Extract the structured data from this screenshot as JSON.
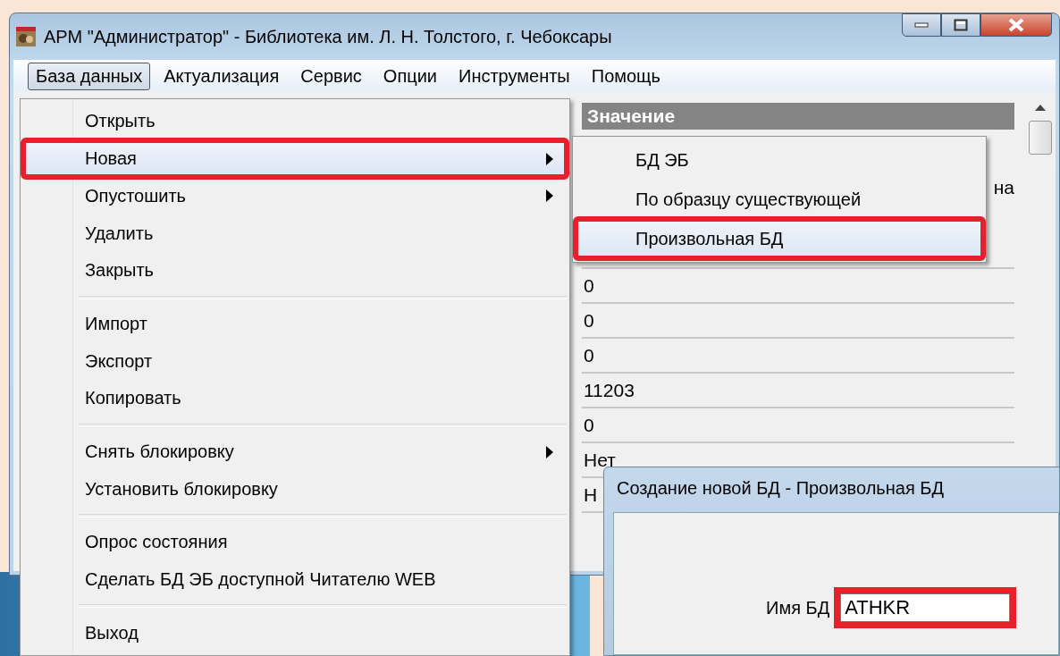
{
  "window": {
    "title": "АРМ \"Администратор\" - Библиотека им. Л. Н. Толстого, г. Чебоксары"
  },
  "menu_bar": [
    {
      "label": "База данных",
      "selected": true
    },
    {
      "label": "Актуализация",
      "selected": false
    },
    {
      "label": "Сервис",
      "selected": false
    },
    {
      "label": "Опции",
      "selected": false
    },
    {
      "label": "Инструменты",
      "selected": false
    },
    {
      "label": "Помощь",
      "selected": false
    }
  ],
  "table": {
    "columns": [
      "Значение"
    ],
    "rows": [
      {
        "value": "на",
        "kind": "clipped"
      },
      {
        "value": "0",
        "kind": "plain"
      },
      {
        "value": "0",
        "kind": "plain"
      },
      {
        "value": "0",
        "kind": "plain"
      },
      {
        "value": "11203",
        "kind": "plain"
      },
      {
        "value": "0",
        "kind": "plain"
      },
      {
        "value": "Нет",
        "kind": "plain"
      },
      {
        "value": "Н",
        "kind": "plain"
      }
    ]
  },
  "menu": {
    "groups": [
      [
        {
          "label": "Открыть",
          "submenu": false,
          "selected": false,
          "annotated": false
        },
        {
          "label": "Новая",
          "submenu": true,
          "selected": true,
          "annotated": true
        },
        {
          "label": "Опустошить",
          "submenu": true,
          "selected": false,
          "annotated": false
        },
        {
          "label": "Удалить",
          "submenu": false,
          "selected": false,
          "annotated": false
        },
        {
          "label": "Закрыть",
          "submenu": false,
          "selected": false,
          "annotated": false
        }
      ],
      [
        {
          "label": "Импорт",
          "submenu": false,
          "selected": false,
          "annotated": false
        },
        {
          "label": "Экспорт",
          "submenu": false,
          "selected": false,
          "annotated": false
        },
        {
          "label": "Копировать",
          "submenu": false,
          "selected": false,
          "annotated": false
        }
      ],
      [
        {
          "label": "Снять блокировку",
          "submenu": true,
          "selected": false,
          "annotated": false
        },
        {
          "label": "Установить блокировку",
          "submenu": false,
          "selected": false,
          "annotated": false
        }
      ],
      [
        {
          "label": "Опрос состояния",
          "submenu": false,
          "selected": false,
          "annotated": false
        },
        {
          "label": "Сделать БД ЭБ доступной Читателю WEB",
          "submenu": false,
          "selected": false,
          "annotated": false
        }
      ],
      [
        {
          "label": "Выход",
          "submenu": false,
          "selected": false,
          "annotated": false
        }
      ]
    ]
  },
  "submenu": {
    "items": [
      {
        "label": "БД ЭБ",
        "selected": false,
        "annotated": false
      },
      {
        "label": "По образцу существующей",
        "selected": false,
        "annotated": false
      },
      {
        "label": "Произвольная БД",
        "selected": true,
        "annotated": true
      }
    ]
  },
  "dialog": {
    "title": "Создание новой БД - Произвольная БД",
    "fields": [
      {
        "label": "Имя БД",
        "value": "ATHKR",
        "annotated": true
      }
    ]
  }
}
